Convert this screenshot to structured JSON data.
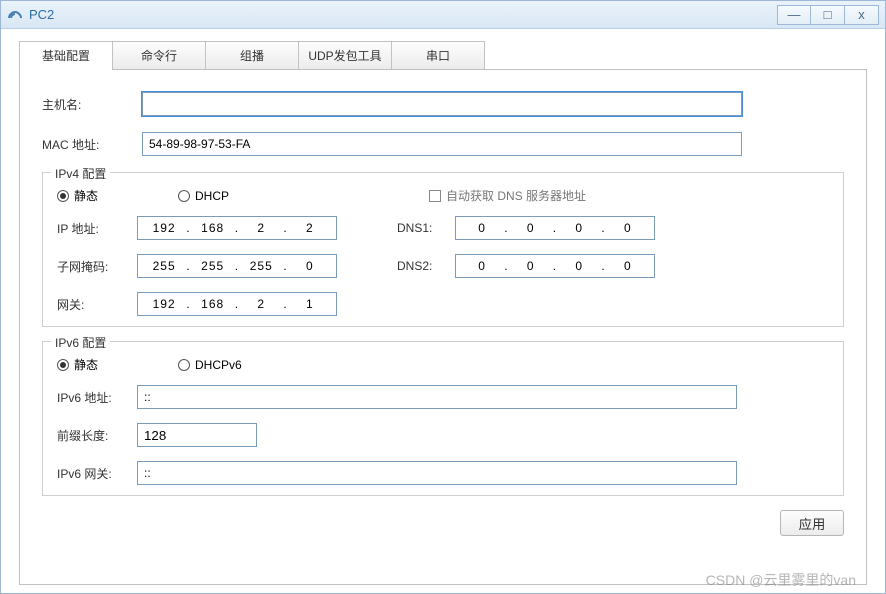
{
  "window": {
    "title": "PC2"
  },
  "tabs": [
    "基础配置",
    "命令行",
    "组播",
    "UDP发包工具",
    "串口"
  ],
  "active_tab": 0,
  "form": {
    "hostname_label": "主机名:",
    "hostname_value": "",
    "mac_label": "MAC 地址:",
    "mac_value": "54-89-98-97-53-FA"
  },
  "ipv4": {
    "legend": "IPv4 配置",
    "radio_static": "静态",
    "radio_dhcp": "DHCP",
    "auto_dns": "自动获取 DNS 服务器地址",
    "ip_label": "IP 地址:",
    "ip": [
      "192",
      "168",
      "2",
      "2"
    ],
    "mask_label": "子网掩码:",
    "mask": [
      "255",
      "255",
      "255",
      "0"
    ],
    "gw_label": "网关:",
    "gw": [
      "192",
      "168",
      "2",
      "1"
    ],
    "dns1_label": "DNS1:",
    "dns1": [
      "0",
      "0",
      "0",
      "0"
    ],
    "dns2_label": "DNS2:",
    "dns2": [
      "0",
      "0",
      "0",
      "0"
    ],
    "mode": "static"
  },
  "ipv6": {
    "legend": "IPv6 配置",
    "radio_static": "静态",
    "radio_dhcp": "DHCPv6",
    "addr_label": "IPv6 地址:",
    "addr": "::",
    "prefix_label": "前缀长度:",
    "prefix": "128",
    "gw_label": "IPv6 网关:",
    "gw": "::",
    "mode": "static"
  },
  "apply_label": "应用",
  "watermark": "CSDN @云里雾里的van"
}
